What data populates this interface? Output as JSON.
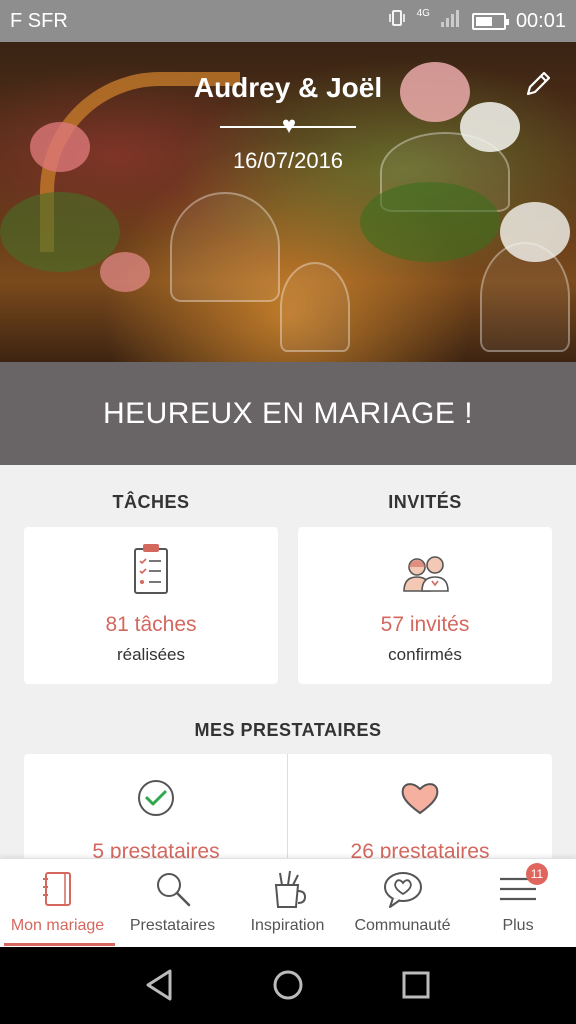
{
  "status_bar": {
    "carrier": "F SFR",
    "network": "4G",
    "time": "00:01"
  },
  "hero": {
    "couple_names": "Audrey & Joël",
    "date": "16/07/2016"
  },
  "banner": {
    "text": "HEUREUX EN MARIAGE !"
  },
  "tasks": {
    "title": "TÂCHES",
    "count": "81 tâches",
    "subtitle": "réalisées"
  },
  "guests": {
    "title": "INVITÉS",
    "count": "57 invités",
    "subtitle": "confirmés"
  },
  "vendors": {
    "title": "MES PRESTATAIRES",
    "booked_count": "5 prestataires",
    "favorite_count": "26 prestataires"
  },
  "tabs": [
    {
      "label": "Mon mariage",
      "icon": "notebook-icon",
      "active": true
    },
    {
      "label": "Prestataires",
      "icon": "search-icon",
      "active": false
    },
    {
      "label": "Inspiration",
      "icon": "pencil-cup-icon",
      "active": false
    },
    {
      "label": "Communauté",
      "icon": "chat-heart-icon",
      "active": false
    },
    {
      "label": "Plus",
      "icon": "menu-icon",
      "active": false,
      "badge": "11"
    }
  ],
  "colors": {
    "accent": "#d4685f",
    "banner": "#696566",
    "background": "#f0f0f0"
  }
}
